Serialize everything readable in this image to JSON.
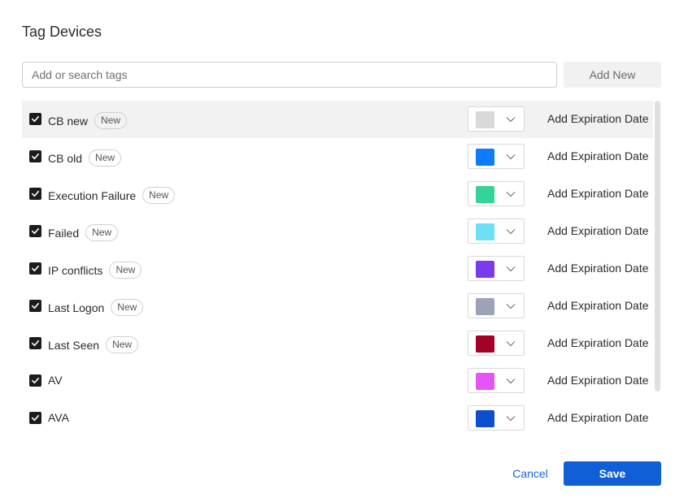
{
  "dialog": {
    "title": "Tag Devices",
    "search_placeholder": "Add or search tags",
    "add_new_label": "Add New",
    "cancel_label": "Cancel",
    "save_label": "Save"
  },
  "tags": [
    {
      "name": "CB new",
      "badge": "New",
      "checked": true,
      "color": "#d9d9d9",
      "expiration_label": "Add Expiration Date"
    },
    {
      "name": "CB old",
      "badge": "New",
      "checked": true,
      "color": "#0d7cfb",
      "expiration_label": "Add Expiration Date"
    },
    {
      "name": "Execution Failure",
      "badge": "New",
      "checked": true,
      "color": "#34d399",
      "expiration_label": "Add Expiration Date"
    },
    {
      "name": "Failed",
      "badge": "New",
      "checked": true,
      "color": "#6ee0f3",
      "expiration_label": "Add Expiration Date"
    },
    {
      "name": "IP conflicts",
      "badge": "New",
      "checked": true,
      "color": "#7c3aed",
      "expiration_label": "Add Expiration Date"
    },
    {
      "name": "Last Logon",
      "badge": "New",
      "checked": true,
      "color": "#9ca3b8",
      "expiration_label": "Add Expiration Date"
    },
    {
      "name": "Last Seen",
      "badge": "New",
      "checked": true,
      "color": "#a30026",
      "expiration_label": "Add Expiration Date"
    },
    {
      "name": "AV",
      "badge": "",
      "checked": true,
      "color": "#e654f5",
      "expiration_label": "Add Expiration Date"
    },
    {
      "name": "AVA",
      "badge": "",
      "checked": true,
      "color": "#0b4fcf",
      "expiration_label": "Add Expiration Date"
    }
  ],
  "icons": {
    "checkbox": "check-icon",
    "dropdown": "chevron-down-icon"
  }
}
